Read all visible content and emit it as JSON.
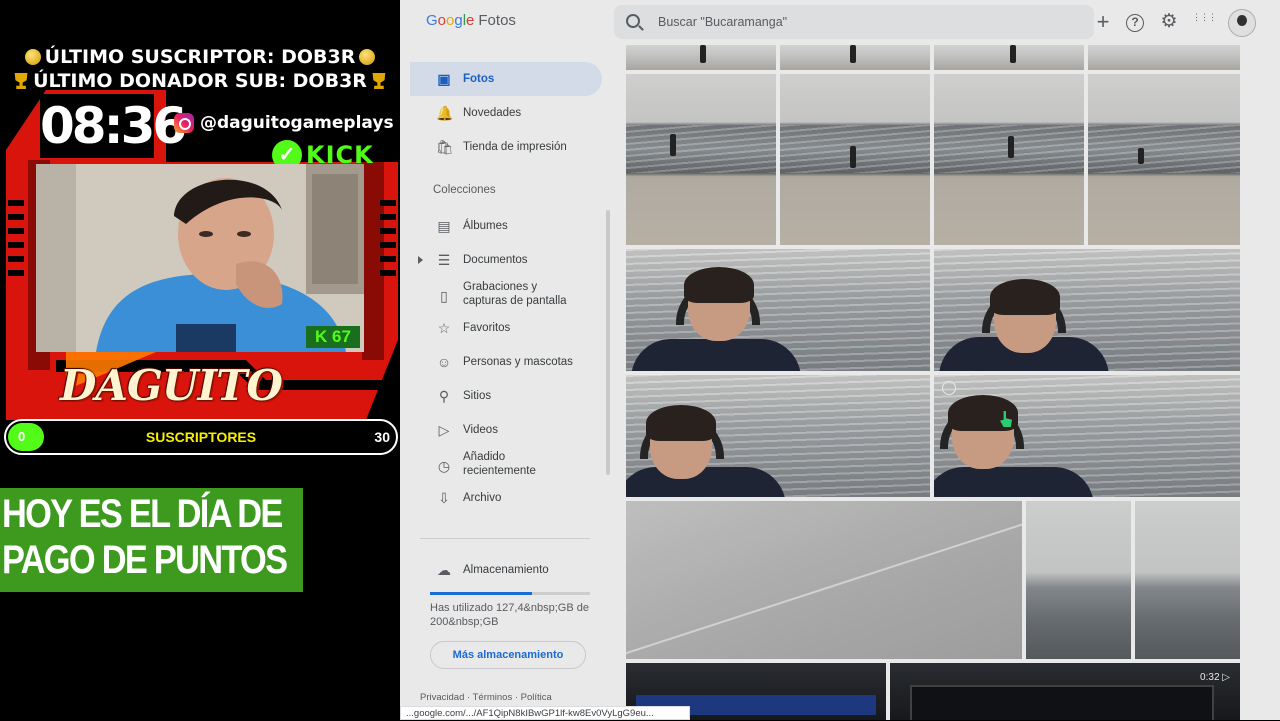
{
  "overlay": {
    "last_subscriber": "ÚLTIMO SUSCRIPTOR: DOB3R",
    "last_donor": "ÚLTIMO DONADOR SUB: DOB3R",
    "clock": "08:36",
    "instagram_handle": "@daguitogameplays",
    "kick_label": "KICK",
    "kick_count": "K 67",
    "streamer_name": "DAGUITO",
    "subs_bar": {
      "min": "0",
      "label": "SUSCRIPTORES",
      "max": "30",
      "progress": 0
    },
    "banner_line1": "HOY ES EL DÍA DE",
    "banner_line2": "PAGO DE PUNTOS",
    "colors": {
      "kick_green": "#53fc18",
      "frame_red": "#e01a10",
      "banner_green": "#3d9a1f",
      "subs_label_yellow": "#f6f000"
    }
  },
  "app": {
    "logo_google": [
      "G",
      "o",
      "o",
      "g",
      "l",
      "e"
    ],
    "logo_product": "Fotos",
    "search_placeholder": "Buscar \"Bucaramanga\"",
    "header_icons": [
      "plus-icon",
      "help-icon",
      "settings-icon",
      "apps-grid-icon",
      "account-avatar"
    ],
    "header_glyphs": {
      "plus": "+",
      "help": "?",
      "settings": "⚙",
      "apps": "⋮⋮⋮"
    },
    "sidebar": {
      "primary": [
        {
          "label": "Fotos",
          "icon": "photo-icon",
          "glyph": "▣",
          "active": true
        },
        {
          "label": "Novedades",
          "icon": "bell-icon",
          "glyph": "🔔"
        },
        {
          "label": "Tienda de impresión",
          "icon": "shopping-bag-icon",
          "glyph": "🛍"
        }
      ],
      "collections_heading": "Colecciones",
      "collections": [
        {
          "label": "Álbumes",
          "icon": "album-icon",
          "glyph": "▤"
        },
        {
          "label": "Documentos",
          "icon": "document-icon",
          "glyph": "☰"
        },
        {
          "label": "Grabaciones y capturas de pantalla",
          "label_line1": "Grabaciones y",
          "label_line2": "capturas de pantalla",
          "icon": "screenshot-icon",
          "glyph": "▯"
        },
        {
          "label": "Favoritos",
          "icon": "star-icon",
          "glyph": "☆"
        },
        {
          "label": "Personas y mascotas",
          "icon": "face-icon",
          "glyph": "☺"
        },
        {
          "label": "Sitios",
          "icon": "location-pin-icon",
          "glyph": "⚲"
        },
        {
          "label": "Videos",
          "icon": "play-circle-icon",
          "glyph": "▷"
        },
        {
          "label": "Añadido recientemente",
          "label_line1": "Añadido",
          "label_line2": "recientemente",
          "icon": "clock-icon",
          "glyph": "◷"
        },
        {
          "label": "Archivo",
          "icon": "archive-icon",
          "glyph": "⇩"
        }
      ],
      "storage": {
        "label": "Almacenamiento",
        "icon": "cloud-icon",
        "glyph": "☁",
        "usage_text": "Has utilizado 127,4&nbsp;GB de 200&nbsp;GB",
        "used_fraction": 0.637,
        "more_button": "Más almacenamiento"
      },
      "footer": "Privacidad · Términos · Política"
    },
    "video_duration": "0:32",
    "status_url": "...google.com/.../AF1QipN8kIBwGP1lf-kw8Ev0VyLgG9eu..."
  }
}
